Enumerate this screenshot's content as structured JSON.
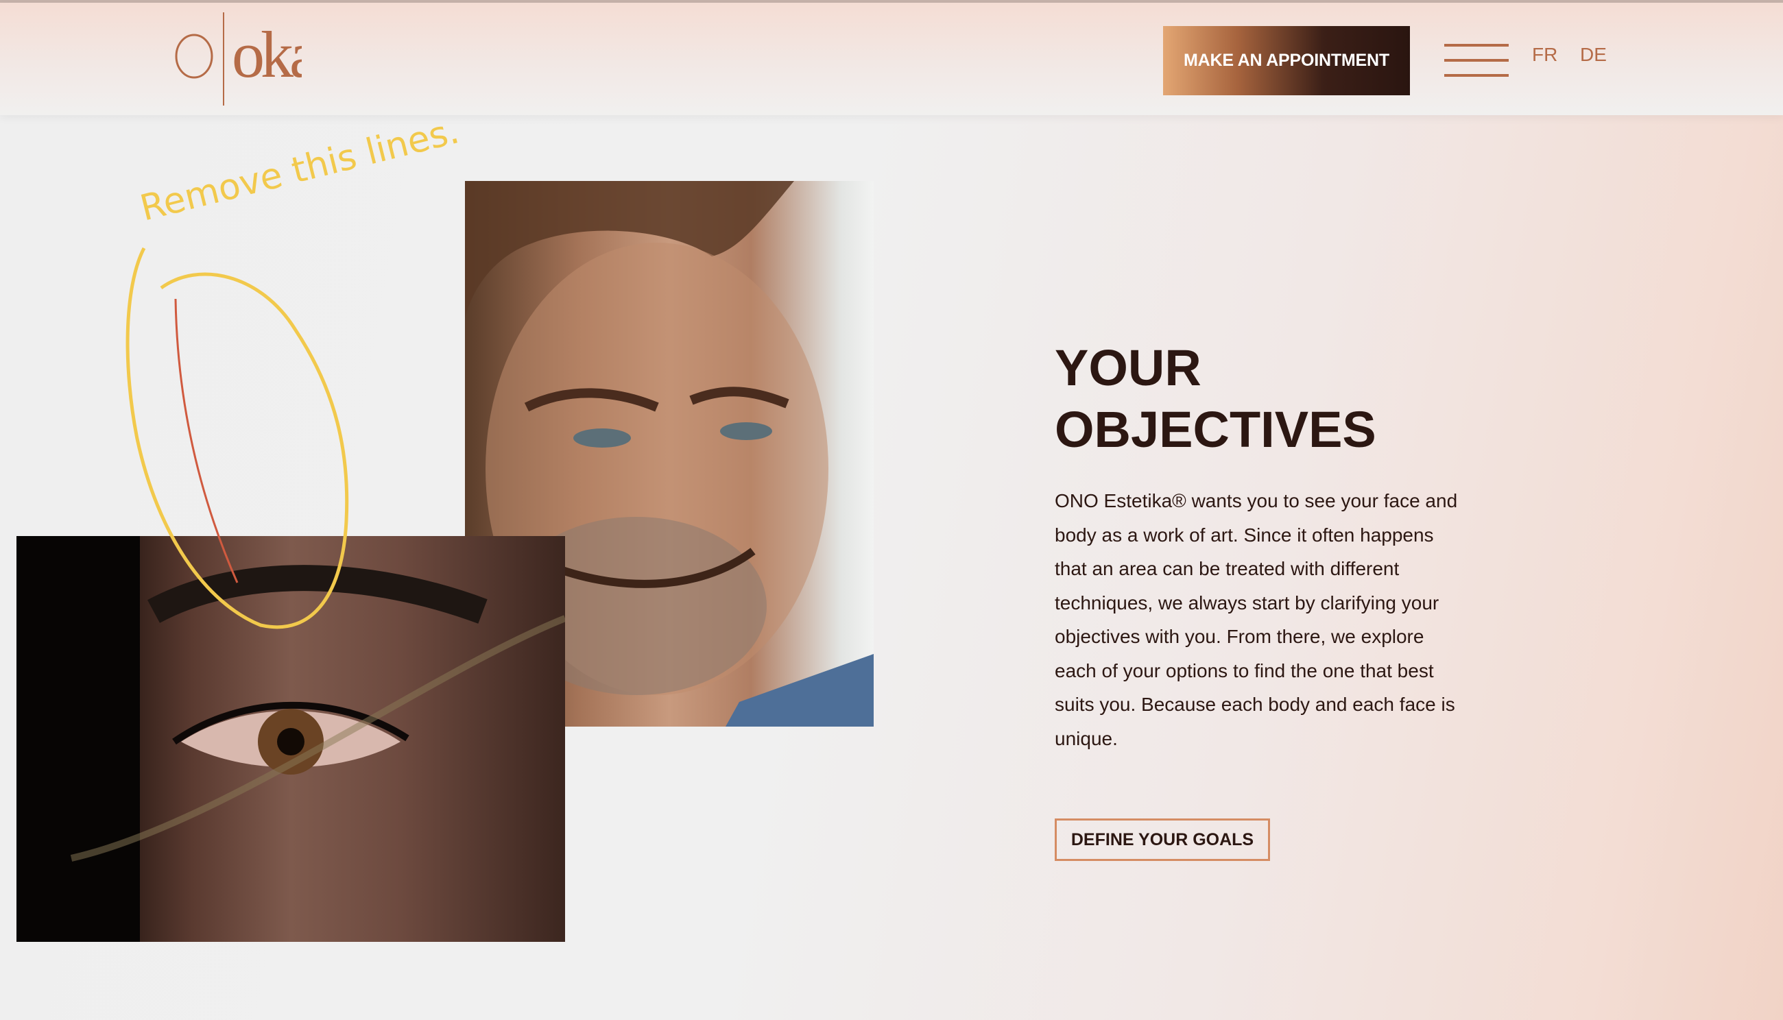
{
  "header": {
    "logo": {
      "text": "oka"
    },
    "appointment_button": "MAKE AN APPOINTMENT",
    "menu_icon": "hamburger-menu-icon",
    "languages": [
      "FR",
      "DE"
    ]
  },
  "objectives": {
    "title_line1": "YOUR",
    "title_line2": "OBJECTIVES",
    "body": "ONO Estetika® wants you to see your face and body as a work of art. Since it often happens that an area can be treated with different techniques, we always start by clarifying your objectives with you. From there, we explore each of your options to find the one that best suits you. Because each body and each face is unique.",
    "button": "DEFINE YOUR GOALS"
  },
  "annotation": {
    "handwritten_text": "Remove this lines.",
    "color": "#f2c94c"
  },
  "colors": {
    "brand_copper": "#b56b47",
    "text_dark": "#2c1712",
    "button_border": "#d58c63"
  }
}
